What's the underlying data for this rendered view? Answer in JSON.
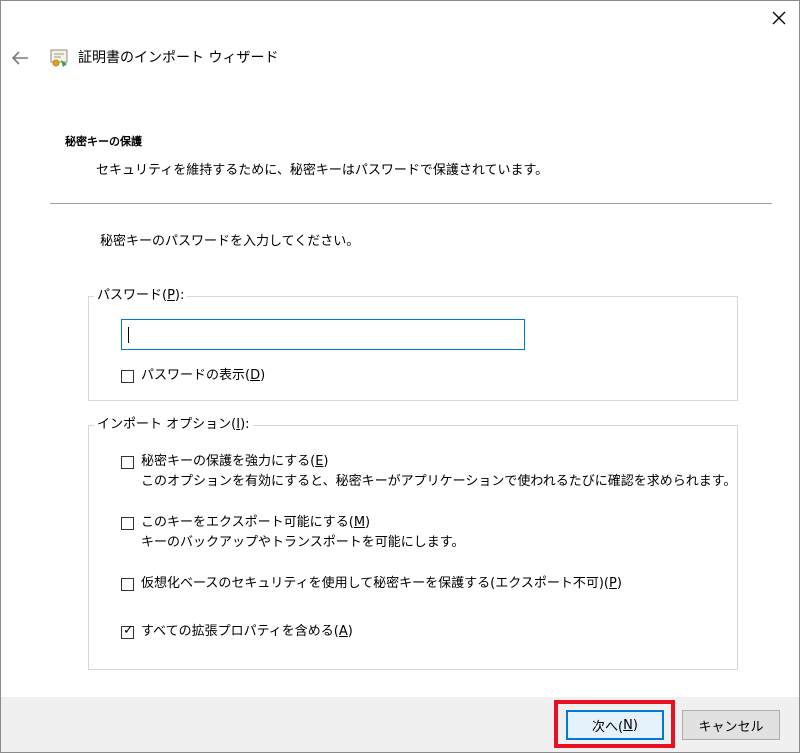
{
  "wizard": {
    "title": "証明書のインポート ウィザード",
    "close_icon": "close-icon",
    "back_icon": "back-arrow-icon",
    "title_icon": "certificate-icon"
  },
  "section": {
    "heading": "秘密キーの保護",
    "description": "セキュリティを維持するために、秘密キーはパスワードで保護されています。"
  },
  "prompt": "秘密キーのパスワードを入力してください。",
  "password_group": {
    "legend": "パスワード(P):",
    "input_value": "",
    "show_password": {
      "label": "パスワードの表示(D)",
      "checked": false
    }
  },
  "options_group": {
    "legend": "インポート オプション(I):",
    "options": [
      {
        "label": "秘密キーの保護を強力にする(E)",
        "description": "このオプションを有効にすると、秘密キーがアプリケーションで使われるたびに確認を求められます。",
        "checked": false
      },
      {
        "label": "このキーをエクスポート可能にする(M)",
        "description": "キーのバックアップやトランスポートを可能にします。",
        "checked": false
      },
      {
        "label": "仮想化ベースのセキュリティを使用して秘密キーを保護する(エクスポート不可)(P)",
        "description": "",
        "checked": false
      },
      {
        "label": "すべての拡張プロパティを含める(A)",
        "description": "",
        "checked": true
      }
    ]
  },
  "footer": {
    "next_label": "次へ(N)",
    "cancel_label": "キャンセル"
  },
  "colors": {
    "focus_blue": "#0078d7",
    "highlight_red": "#e81123",
    "footer_bg": "#f0f0f0"
  }
}
